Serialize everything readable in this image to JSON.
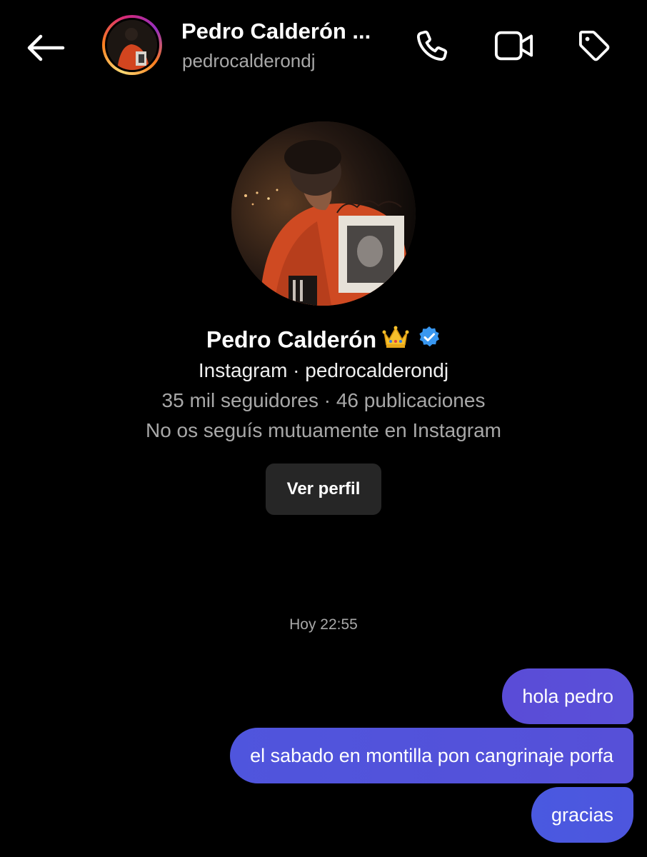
{
  "header": {
    "title": "Pedro Calderón ...",
    "username": "pedrocalderondj"
  },
  "profile": {
    "name": "Pedro Calderón",
    "crown_emoji": "👑",
    "source_line": "Instagram · pedrocalderondj",
    "stats_line": "35 mil seguidores · 46 publicaciones",
    "follow_status": "No os seguís mutuamente en Instagram",
    "view_profile_label": "Ver perfil"
  },
  "conversation": {
    "timestamp": "Hoy 22:55",
    "messages": [
      {
        "text": "hola pedro",
        "sender": "me"
      },
      {
        "text": "el sabado en montilla pon cangrinaje porfa",
        "sender": "me"
      },
      {
        "text": "gracias",
        "sender": "me"
      }
    ]
  },
  "icons": {
    "back": "arrow-left-icon",
    "call": "phone-icon",
    "video": "video-camera-icon",
    "tag": "tag-icon",
    "verified": "verified-badge-icon"
  },
  "colors": {
    "background": "#000000",
    "bubble": "#5b4fd6",
    "secondary_text": "#a8a8a8",
    "button_bg": "#262626",
    "verified_blue": "#3897f0"
  }
}
